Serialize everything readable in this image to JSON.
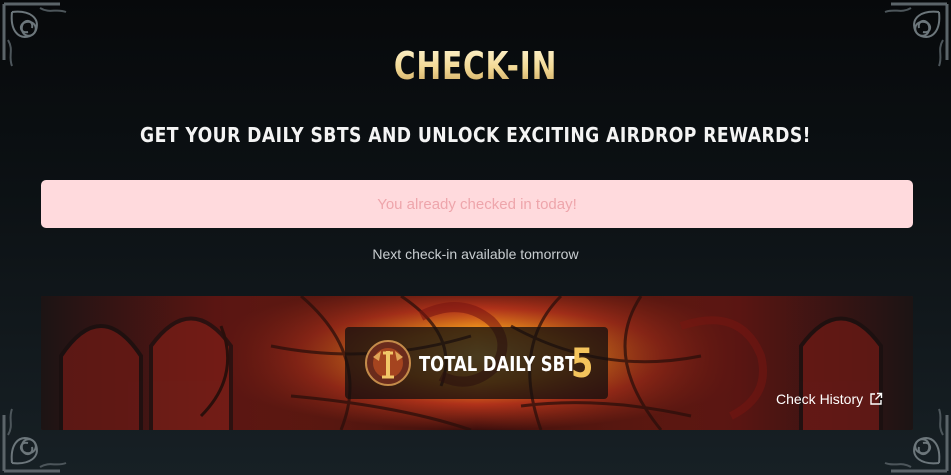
{
  "header": {
    "title": "CHECK-IN",
    "subtitle": "GET YOUR DAILY SBTS AND UNLOCK EXCITING AIRDROP REWARDS!"
  },
  "status": {
    "message": "You already checked in today!",
    "next_checkin": "Next check-in available tomorrow"
  },
  "sbt_panel": {
    "label": "TOTAL DAILY SBT",
    "value": "5",
    "medal_icon": "dragon-medal-icon"
  },
  "history": {
    "label": "Check History",
    "icon": "external-link-icon"
  },
  "colors": {
    "title_gold": "#f2d893",
    "value_gold": "#f4c45c",
    "banner_bg": "#ffdadd",
    "banner_text": "#eea5ab",
    "page_bg": "#0c1114"
  }
}
